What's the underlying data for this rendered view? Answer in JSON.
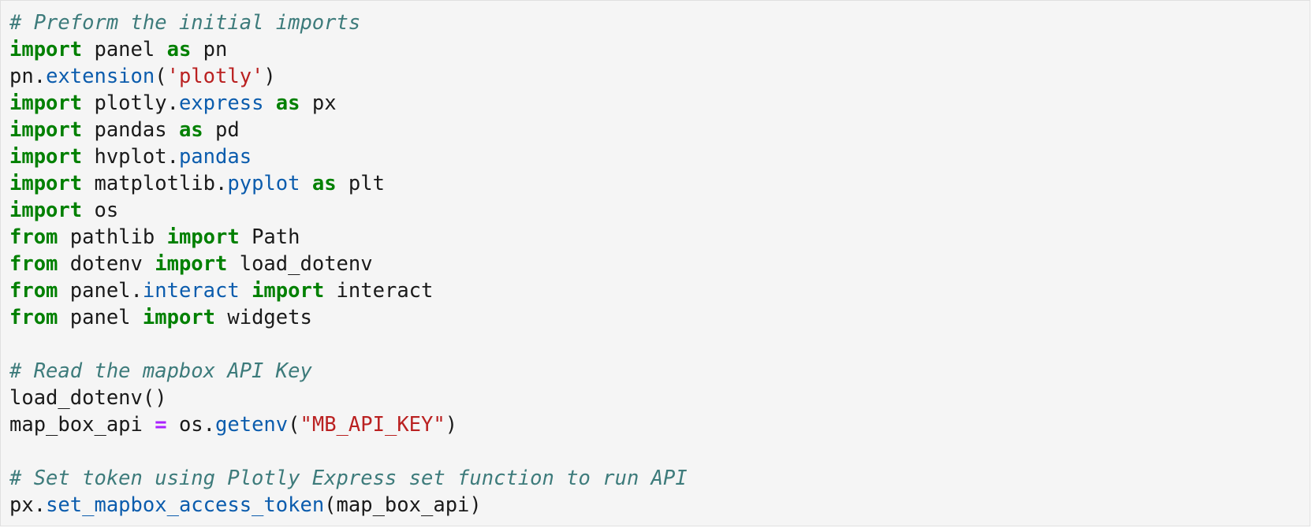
{
  "colors": {
    "keyword": "#008000",
    "comment": "#3d7b7b",
    "string": "#ba2121",
    "attribute": "#0b5cad",
    "operator": "#aa22ff",
    "text": "#1a1a1a",
    "background": "#f5f5f5"
  },
  "code": {
    "lines": [
      [
        {
          "t": "# Preform the initial imports",
          "c": "cm"
        }
      ],
      [
        {
          "t": "import",
          "c": "kw"
        },
        {
          "t": " panel ",
          "c": "tx"
        },
        {
          "t": "as",
          "c": "kw"
        },
        {
          "t": " pn",
          "c": "tx"
        }
      ],
      [
        {
          "t": "pn.",
          "c": "tx"
        },
        {
          "t": "extension",
          "c": "at"
        },
        {
          "t": "(",
          "c": "tx"
        },
        {
          "t": "'plotly'",
          "c": "st"
        },
        {
          "t": ")",
          "c": "tx"
        }
      ],
      [
        {
          "t": "import",
          "c": "kw"
        },
        {
          "t": " plotly.",
          "c": "tx"
        },
        {
          "t": "express",
          "c": "at"
        },
        {
          "t": " ",
          "c": "tx"
        },
        {
          "t": "as",
          "c": "kw"
        },
        {
          "t": " px",
          "c": "tx"
        }
      ],
      [
        {
          "t": "import",
          "c": "kw"
        },
        {
          "t": " pandas ",
          "c": "tx"
        },
        {
          "t": "as",
          "c": "kw"
        },
        {
          "t": " pd",
          "c": "tx"
        }
      ],
      [
        {
          "t": "import",
          "c": "kw"
        },
        {
          "t": " hvplot.",
          "c": "tx"
        },
        {
          "t": "pandas",
          "c": "at"
        }
      ],
      [
        {
          "t": "import",
          "c": "kw"
        },
        {
          "t": " matplotlib.",
          "c": "tx"
        },
        {
          "t": "pyplot",
          "c": "at"
        },
        {
          "t": " ",
          "c": "tx"
        },
        {
          "t": "as",
          "c": "kw"
        },
        {
          "t": " plt",
          "c": "tx"
        }
      ],
      [
        {
          "t": "import",
          "c": "kw"
        },
        {
          "t": " os",
          "c": "tx"
        }
      ],
      [
        {
          "t": "from",
          "c": "kw"
        },
        {
          "t": " pathlib ",
          "c": "tx"
        },
        {
          "t": "import",
          "c": "kw"
        },
        {
          "t": " Path",
          "c": "tx"
        }
      ],
      [
        {
          "t": "from",
          "c": "kw"
        },
        {
          "t": " dotenv ",
          "c": "tx"
        },
        {
          "t": "import",
          "c": "kw"
        },
        {
          "t": " load_dotenv",
          "c": "tx"
        }
      ],
      [
        {
          "t": "from",
          "c": "kw"
        },
        {
          "t": " panel.",
          "c": "tx"
        },
        {
          "t": "interact",
          "c": "at"
        },
        {
          "t": " ",
          "c": "tx"
        },
        {
          "t": "import",
          "c": "kw"
        },
        {
          "t": " interact",
          "c": "tx"
        }
      ],
      [
        {
          "t": "from",
          "c": "kw"
        },
        {
          "t": " panel ",
          "c": "tx"
        },
        {
          "t": "import",
          "c": "kw"
        },
        {
          "t": " widgets",
          "c": "tx"
        }
      ],
      [],
      [
        {
          "t": "# Read the mapbox API Key",
          "c": "cm"
        }
      ],
      [
        {
          "t": "load_dotenv()",
          "c": "tx"
        }
      ],
      [
        {
          "t": "map_box_api ",
          "c": "tx"
        },
        {
          "t": "=",
          "c": "op"
        },
        {
          "t": " os.",
          "c": "tx"
        },
        {
          "t": "getenv",
          "c": "at"
        },
        {
          "t": "(",
          "c": "tx"
        },
        {
          "t": "\"MB_API_KEY\"",
          "c": "st"
        },
        {
          "t": ")",
          "c": "tx"
        }
      ],
      [],
      [
        {
          "t": "# Set token using Plotly Express set function to run API",
          "c": "cm"
        }
      ],
      [
        {
          "t": "px.",
          "c": "tx"
        },
        {
          "t": "set_mapbox_access_token",
          "c": "at"
        },
        {
          "t": "(map_box_api)",
          "c": "tx"
        }
      ]
    ]
  }
}
